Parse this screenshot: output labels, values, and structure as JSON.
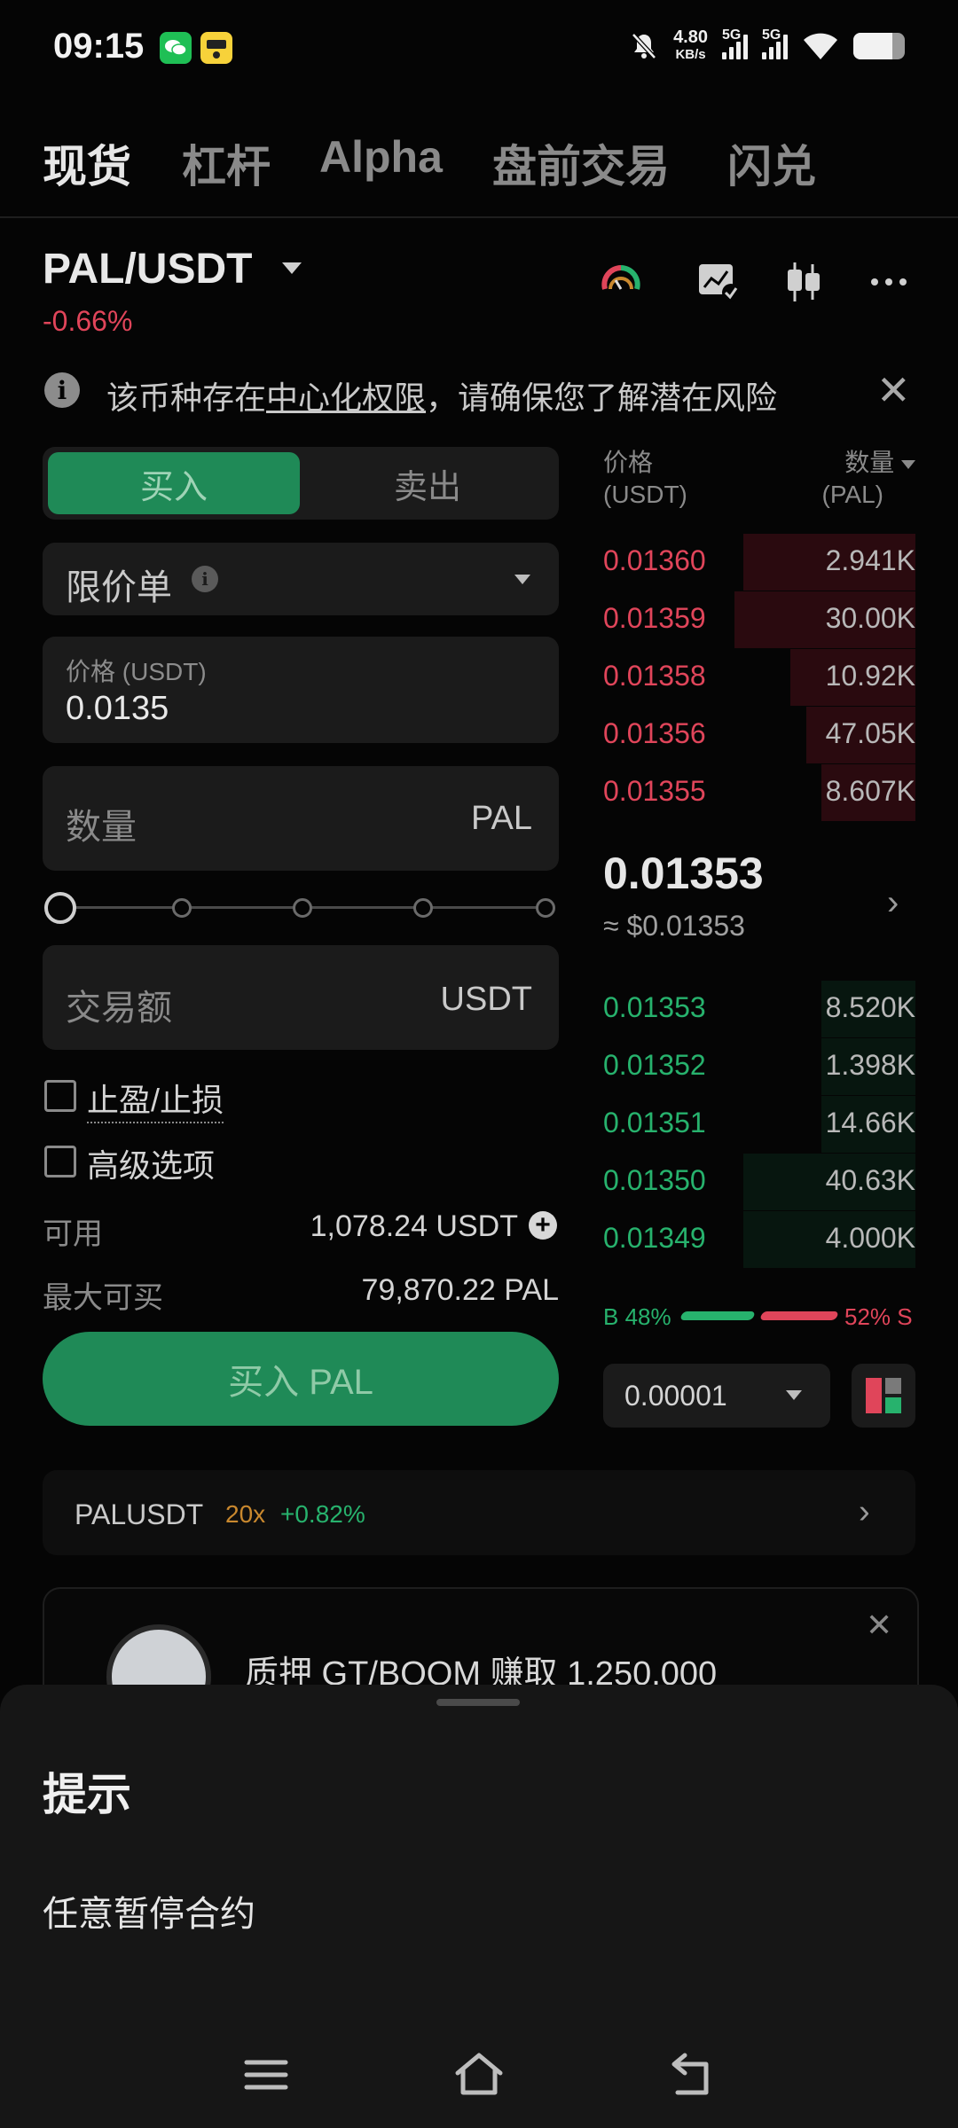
{
  "status_bar": {
    "time": "09:15",
    "net_speed_value": "4.80",
    "net_speed_unit": "KB/s",
    "signal1": "5G",
    "signal2": "5G",
    "battery_level": 0.75,
    "icons": [
      "wechat-icon",
      "app-icon",
      "mute-icon",
      "wifi-icon",
      "battery-icon"
    ]
  },
  "top_tabs": [
    "现货",
    "杠杆",
    "Alpha",
    "盘前交易",
    "闪兑"
  ],
  "pair": {
    "symbol": "PAL/USDT",
    "change": "-0.66%"
  },
  "notice": {
    "prefix": "该币种存在",
    "link": "中心化权限",
    "suffix": "，请确保您了解潜在风险"
  },
  "order_form": {
    "buy_label": "买入",
    "sell_label": "卖出",
    "order_type": "限价单",
    "price_label": "价格 (USDT)",
    "price_value": "0.0135",
    "qty_label": "数量",
    "qty_unit": "PAL",
    "slider_level": 0,
    "amount_label": "交易额",
    "amount_unit": "USDT",
    "tp_sl_label": "止盈/止损",
    "advanced_label": "高级选项",
    "available_label": "可用",
    "available_value": "1,078.24 USDT",
    "max_buy_label": "最大可买",
    "max_buy_value": "79,870.22 PAL",
    "submit_label": "买入 PAL"
  },
  "order_book": {
    "price_header": "价格",
    "price_unit": "(USDT)",
    "qty_header": "数量",
    "qty_unit": "(PAL)",
    "asks": [
      {
        "price": "0.01360",
        "qty": "2.941K",
        "depth": 0.55
      },
      {
        "price": "0.01359",
        "qty": "30.00K",
        "depth": 0.58
      },
      {
        "price": "0.01358",
        "qty": "10.92K",
        "depth": 0.4
      },
      {
        "price": "0.01356",
        "qty": "47.05K",
        "depth": 0.35
      },
      {
        "price": "0.01355",
        "qty": "8.607K",
        "depth": 0.3
      }
    ],
    "mid_price": "0.01353",
    "mid_usd": "≈ $0.01353",
    "bids": [
      {
        "price": "0.01353",
        "qty": "8.520K",
        "depth": 0.3
      },
      {
        "price": "0.01352",
        "qty": "1.398K",
        "depth": 0.3
      },
      {
        "price": "0.01351",
        "qty": "14.66K",
        "depth": 0.3
      },
      {
        "price": "0.01350",
        "qty": "40.63K",
        "depth": 0.55
      },
      {
        "price": "0.01349",
        "qty": "4.000K",
        "depth": 0.55
      }
    ],
    "buy_ratio": "B 48%",
    "sell_ratio": "52% S",
    "precision": "0.00001"
  },
  "futures": {
    "name": "PALUSDT",
    "leverage": "20x",
    "change": "+0.82%"
  },
  "promo": {
    "text": "质押 GT/BOOM 赚取 1,250,000"
  },
  "sheet": {
    "title": "提示",
    "body": "任意暂停合约"
  },
  "colors": {
    "green": "#1f8a57",
    "red": "#e0455a",
    "background": "#050505"
  }
}
